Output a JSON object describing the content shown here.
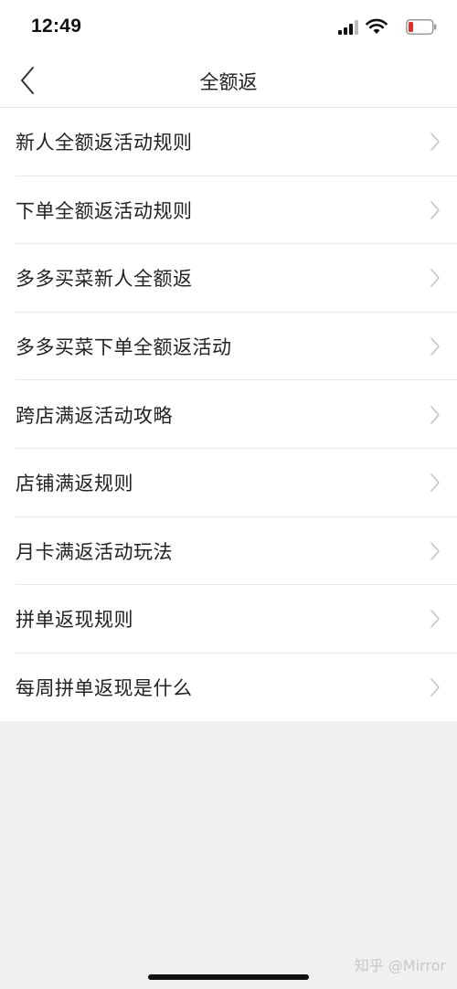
{
  "status_bar": {
    "time": "12:49",
    "icons": [
      "signal-icon",
      "wifi-icon",
      "battery-icon"
    ],
    "battery_color": "#e0302c"
  },
  "nav": {
    "title": "全额返",
    "back_icon": "chevron-left-icon"
  },
  "rules": [
    {
      "label": "新人全额返活动规则"
    },
    {
      "label": "下单全额返活动规则"
    },
    {
      "label": "多多买菜新人全额返"
    },
    {
      "label": "多多买菜下单全额返活动"
    },
    {
      "label": "跨店满返活动攻略"
    },
    {
      "label": "店铺满返规则"
    },
    {
      "label": "月卡满返活动玩法"
    },
    {
      "label": "拼单返现规则"
    },
    {
      "label": "每周拼单返现是什么"
    }
  ],
  "watermark": "知乎 @Mirror",
  "colors": {
    "background": "#f0f0f0",
    "surface": "#ffffff",
    "text": "#222222",
    "chevron": "#c4c4c4"
  }
}
